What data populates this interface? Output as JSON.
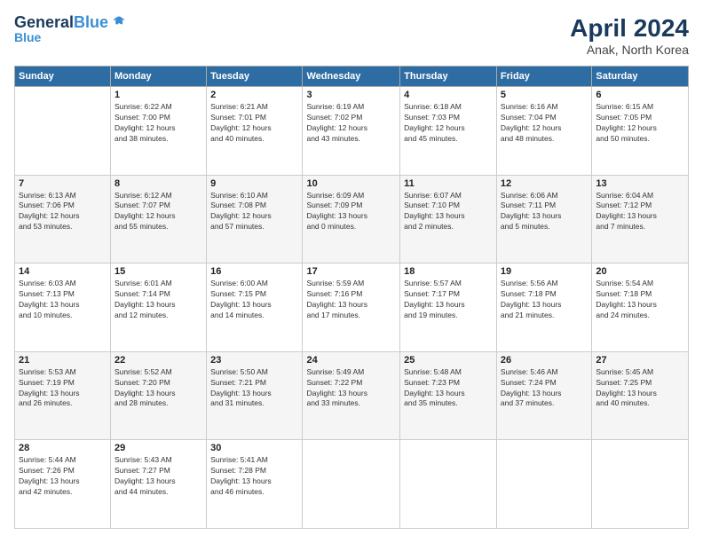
{
  "logo": {
    "line1": "General",
    "line2": "Blue"
  },
  "title": "April 2024",
  "location": "Anak, North Korea",
  "days_of_week": [
    "Sunday",
    "Monday",
    "Tuesday",
    "Wednesday",
    "Thursday",
    "Friday",
    "Saturday"
  ],
  "weeks": [
    [
      {
        "day": "",
        "info": ""
      },
      {
        "day": "1",
        "info": "Sunrise: 6:22 AM\nSunset: 7:00 PM\nDaylight: 12 hours\nand 38 minutes."
      },
      {
        "day": "2",
        "info": "Sunrise: 6:21 AM\nSunset: 7:01 PM\nDaylight: 12 hours\nand 40 minutes."
      },
      {
        "day": "3",
        "info": "Sunrise: 6:19 AM\nSunset: 7:02 PM\nDaylight: 12 hours\nand 43 minutes."
      },
      {
        "day": "4",
        "info": "Sunrise: 6:18 AM\nSunset: 7:03 PM\nDaylight: 12 hours\nand 45 minutes."
      },
      {
        "day": "5",
        "info": "Sunrise: 6:16 AM\nSunset: 7:04 PM\nDaylight: 12 hours\nand 48 minutes."
      },
      {
        "day": "6",
        "info": "Sunrise: 6:15 AM\nSunset: 7:05 PM\nDaylight: 12 hours\nand 50 minutes."
      }
    ],
    [
      {
        "day": "7",
        "info": "Sunrise: 6:13 AM\nSunset: 7:06 PM\nDaylight: 12 hours\nand 53 minutes."
      },
      {
        "day": "8",
        "info": "Sunrise: 6:12 AM\nSunset: 7:07 PM\nDaylight: 12 hours\nand 55 minutes."
      },
      {
        "day": "9",
        "info": "Sunrise: 6:10 AM\nSunset: 7:08 PM\nDaylight: 12 hours\nand 57 minutes."
      },
      {
        "day": "10",
        "info": "Sunrise: 6:09 AM\nSunset: 7:09 PM\nDaylight: 13 hours\nand 0 minutes."
      },
      {
        "day": "11",
        "info": "Sunrise: 6:07 AM\nSunset: 7:10 PM\nDaylight: 13 hours\nand 2 minutes."
      },
      {
        "day": "12",
        "info": "Sunrise: 6:06 AM\nSunset: 7:11 PM\nDaylight: 13 hours\nand 5 minutes."
      },
      {
        "day": "13",
        "info": "Sunrise: 6:04 AM\nSunset: 7:12 PM\nDaylight: 13 hours\nand 7 minutes."
      }
    ],
    [
      {
        "day": "14",
        "info": "Sunrise: 6:03 AM\nSunset: 7:13 PM\nDaylight: 13 hours\nand 10 minutes."
      },
      {
        "day": "15",
        "info": "Sunrise: 6:01 AM\nSunset: 7:14 PM\nDaylight: 13 hours\nand 12 minutes."
      },
      {
        "day": "16",
        "info": "Sunrise: 6:00 AM\nSunset: 7:15 PM\nDaylight: 13 hours\nand 14 minutes."
      },
      {
        "day": "17",
        "info": "Sunrise: 5:59 AM\nSunset: 7:16 PM\nDaylight: 13 hours\nand 17 minutes."
      },
      {
        "day": "18",
        "info": "Sunrise: 5:57 AM\nSunset: 7:17 PM\nDaylight: 13 hours\nand 19 minutes."
      },
      {
        "day": "19",
        "info": "Sunrise: 5:56 AM\nSunset: 7:18 PM\nDaylight: 13 hours\nand 21 minutes."
      },
      {
        "day": "20",
        "info": "Sunrise: 5:54 AM\nSunset: 7:18 PM\nDaylight: 13 hours\nand 24 minutes."
      }
    ],
    [
      {
        "day": "21",
        "info": "Sunrise: 5:53 AM\nSunset: 7:19 PM\nDaylight: 13 hours\nand 26 minutes."
      },
      {
        "day": "22",
        "info": "Sunrise: 5:52 AM\nSunset: 7:20 PM\nDaylight: 13 hours\nand 28 minutes."
      },
      {
        "day": "23",
        "info": "Sunrise: 5:50 AM\nSunset: 7:21 PM\nDaylight: 13 hours\nand 31 minutes."
      },
      {
        "day": "24",
        "info": "Sunrise: 5:49 AM\nSunset: 7:22 PM\nDaylight: 13 hours\nand 33 minutes."
      },
      {
        "day": "25",
        "info": "Sunrise: 5:48 AM\nSunset: 7:23 PM\nDaylight: 13 hours\nand 35 minutes."
      },
      {
        "day": "26",
        "info": "Sunrise: 5:46 AM\nSunset: 7:24 PM\nDaylight: 13 hours\nand 37 minutes."
      },
      {
        "day": "27",
        "info": "Sunrise: 5:45 AM\nSunset: 7:25 PM\nDaylight: 13 hours\nand 40 minutes."
      }
    ],
    [
      {
        "day": "28",
        "info": "Sunrise: 5:44 AM\nSunset: 7:26 PM\nDaylight: 13 hours\nand 42 minutes."
      },
      {
        "day": "29",
        "info": "Sunrise: 5:43 AM\nSunset: 7:27 PM\nDaylight: 13 hours\nand 44 minutes."
      },
      {
        "day": "30",
        "info": "Sunrise: 5:41 AM\nSunset: 7:28 PM\nDaylight: 13 hours\nand 46 minutes."
      },
      {
        "day": "",
        "info": ""
      },
      {
        "day": "",
        "info": ""
      },
      {
        "day": "",
        "info": ""
      },
      {
        "day": "",
        "info": ""
      }
    ]
  ]
}
